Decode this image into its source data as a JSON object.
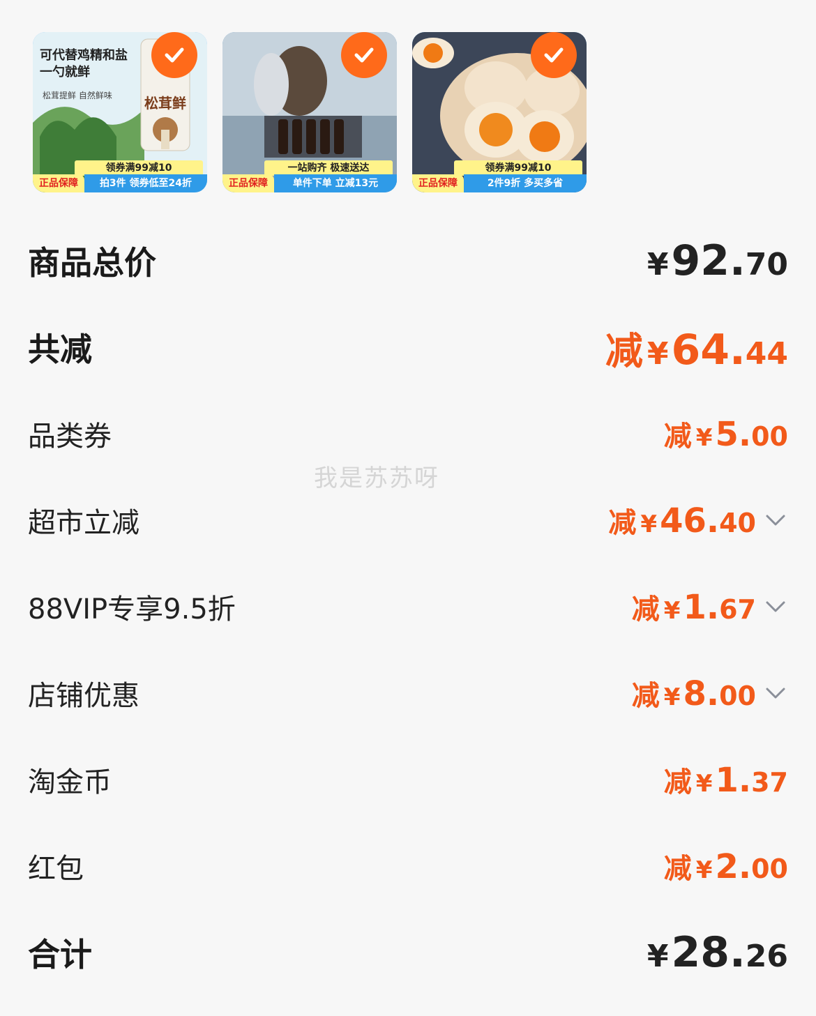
{
  "products": [
    {
      "headline": "可代替鸡精和盐\n一勺就鲜",
      "subtitle": "松茸提鲜 自然鲜味",
      "brand_text": "松茸鲜",
      "promo_top": "领券满99减10",
      "badge": "正品保障",
      "promo_bottom": "拍3件 领券低至24折"
    },
    {
      "headline": "",
      "subtitle": "",
      "brand_text": "",
      "promo_top": "一站购齐 极速送达",
      "badge": "正品保障",
      "promo_bottom": "单件下单 立减13元"
    },
    {
      "headline": "",
      "subtitle": "",
      "brand_text": "",
      "promo_top": "领券满99减10",
      "badge": "正品保障",
      "promo_bottom": "2件9折 多买多省"
    }
  ],
  "summary": {
    "total_label": "商品总价",
    "total_currency": "¥",
    "total_int": "92.",
    "total_dec": "70",
    "saved_label": "共减",
    "saved_prefix": "减",
    "saved_currency": "¥",
    "saved_int": "64.",
    "saved_dec": "44",
    "final_label": "合计",
    "final_currency": "¥",
    "final_int": "28.",
    "final_dec": "26"
  },
  "discounts": [
    {
      "label": "品类券",
      "prefix": "减",
      "currency": "¥",
      "int": "5.",
      "dec": "00",
      "expandable": false
    },
    {
      "label": "超市立减",
      "prefix": "减",
      "currency": "¥",
      "int": "46.",
      "dec": "40",
      "expandable": true
    },
    {
      "label": "88VIP专享9.5折",
      "prefix": "减",
      "currency": "¥",
      "int": "1.",
      "dec": "67",
      "expandable": true
    },
    {
      "label": "店铺优惠",
      "prefix": "减",
      "currency": "¥",
      "int": "8.",
      "dec": "00",
      "expandable": true
    },
    {
      "label": "淘金币",
      "prefix": "减",
      "currency": "¥",
      "int": "1.",
      "dec": "37",
      "expandable": false
    },
    {
      "label": "红包",
      "prefix": "减",
      "currency": "¥",
      "int": "2.",
      "dec": "00",
      "expandable": false
    }
  ],
  "watermark": "我是苏苏呀",
  "colors": {
    "accent": "#f25a1a",
    "check": "#ff6a1a",
    "promo_blue": "#2f9be8",
    "promo_yellow": "#fff38a"
  }
}
